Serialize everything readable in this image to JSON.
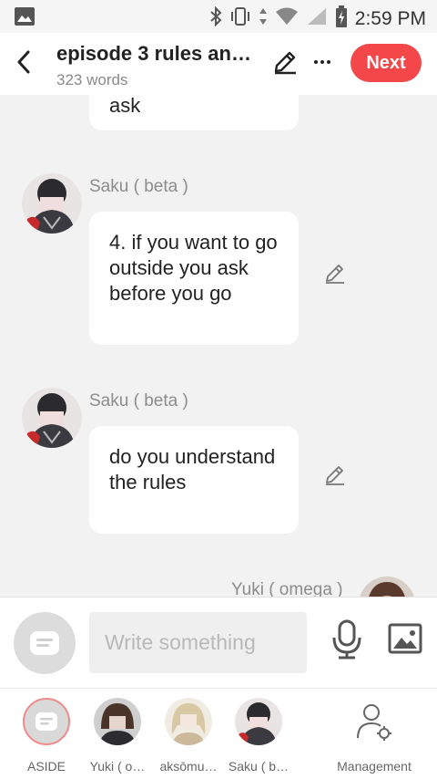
{
  "status_bar": {
    "time": "2:59 PM"
  },
  "header": {
    "title": "episode 3 rules an…",
    "word_count": "323 words",
    "next_label": "Next"
  },
  "messages": [
    {
      "speaker": "",
      "text": "ask"
    },
    {
      "speaker": "Saku ( beta )",
      "text": "4. if you want to go outside you ask before you go"
    },
    {
      "speaker": "Saku ( beta )",
      "text": "do you understand the rules"
    },
    {
      "speaker": "Yuki ( omega )",
      "text": ""
    }
  ],
  "composer": {
    "placeholder": "Write something"
  },
  "bottom_tabs": [
    {
      "label": "ASIDE"
    },
    {
      "label": "Yuki ( o…"
    },
    {
      "label": "aksōmu…"
    },
    {
      "label": "Saku ( b…"
    },
    {
      "label": "Management"
    }
  ],
  "colors": {
    "accent": "#f34749",
    "background": "#f2f2f2"
  }
}
